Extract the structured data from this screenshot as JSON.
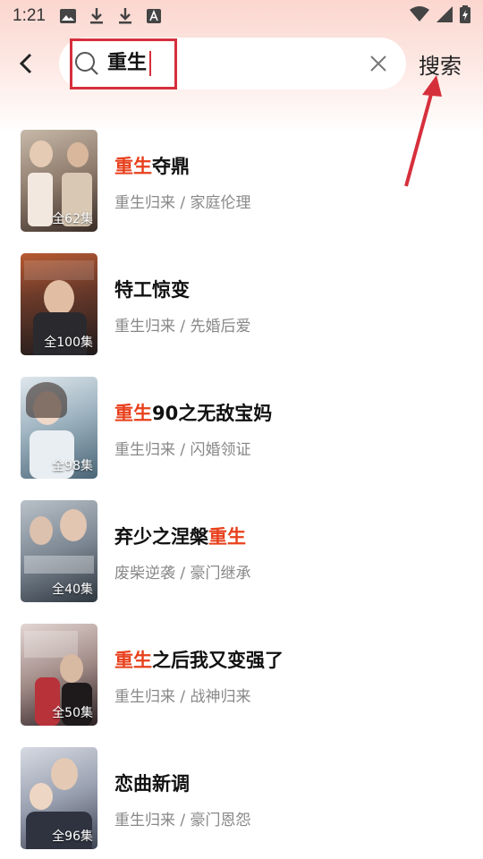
{
  "status_bar": {
    "time": "1:21"
  },
  "search": {
    "query": "重生",
    "button_label": "搜索"
  },
  "results": [
    {
      "title_parts": [
        "重生",
        "夺鼎"
      ],
      "highlight_first": true,
      "tags": "重生归来 / 家庭伦理",
      "episodes": "全62集",
      "poster_colors": [
        "#a89a8a",
        "#5b4a40"
      ]
    },
    {
      "title_parts": [
        "特工惊变",
        ""
      ],
      "highlight_first": false,
      "tags": "重生归来 / 先婚后爱",
      "episodes": "全100集",
      "poster_colors": [
        "#b0542e",
        "#2e2a2a"
      ]
    },
    {
      "title_parts": [
        "重生",
        "90之无敌宝妈"
      ],
      "highlight_first": true,
      "tags": "重生归来 / 闪婚领证",
      "episodes": "全98集",
      "poster_colors": [
        "#c9d6dd",
        "#516b7a"
      ]
    },
    {
      "title_parts": [
        "弃少之涅槃",
        "重生"
      ],
      "highlight_first": false,
      "highlight_second": true,
      "tags": "废柴逆袭 / 豪门继承",
      "episodes": "全40集",
      "poster_colors": [
        "#9fa9b3",
        "#3d4650"
      ]
    },
    {
      "title_parts": [
        "重生",
        "之后我又变强了"
      ],
      "highlight_first": true,
      "tags": "重生归来 / 战神归来",
      "episodes": "全50集",
      "poster_colors": [
        "#d7c7c4",
        "#3a2a2c"
      ]
    },
    {
      "title_parts": [
        "恋曲新调",
        ""
      ],
      "highlight_first": false,
      "tags": "重生归来 / 豪门恩怨",
      "episodes": "全96集",
      "poster_colors": [
        "#c8ccd6",
        "#4a4e5e"
      ]
    }
  ],
  "colors": {
    "highlight": "#e8401c",
    "annotation": "#d62f3c"
  }
}
